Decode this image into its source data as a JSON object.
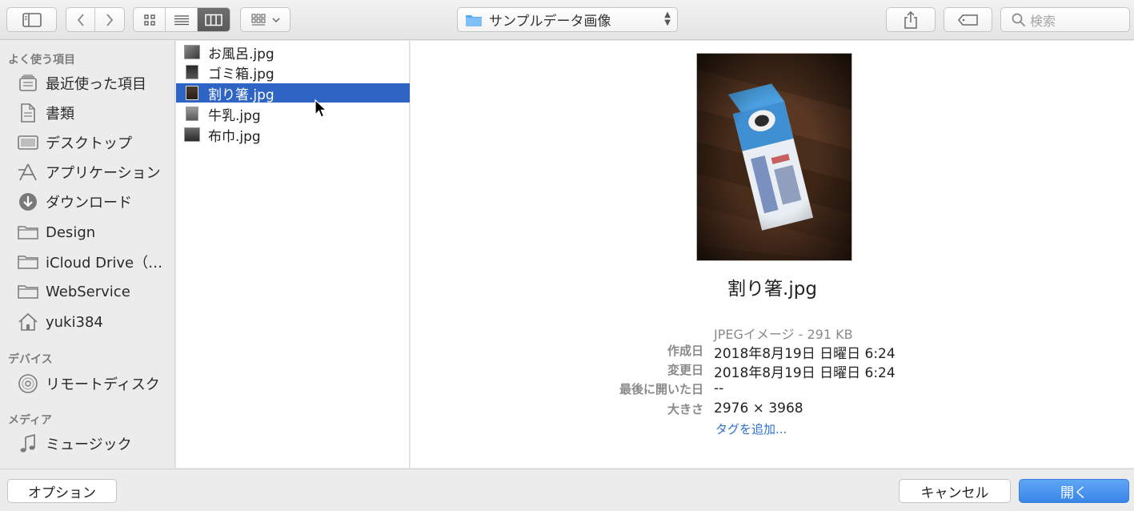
{
  "toolbar": {
    "location": "サンプルデータ画像",
    "search_placeholder": "検索"
  },
  "sidebar": {
    "sections": [
      {
        "heading": "よく使う項目",
        "items": [
          {
            "label": "最近使った項目",
            "icon": "recents-icon"
          },
          {
            "label": "書類",
            "icon": "documents-icon"
          },
          {
            "label": "デスクトップ",
            "icon": "desktop-icon"
          },
          {
            "label": "アプリケーション",
            "icon": "applications-icon"
          },
          {
            "label": "ダウンロード",
            "icon": "downloads-icon"
          },
          {
            "label": "Design",
            "icon": "folder-icon"
          },
          {
            "label": "iCloud Drive（…",
            "icon": "folder-icon"
          },
          {
            "label": "WebService",
            "icon": "folder-icon"
          },
          {
            "label": "yuki384",
            "icon": "home-icon"
          }
        ]
      },
      {
        "heading": "デバイス",
        "items": [
          {
            "label": "リモートディスク",
            "icon": "remote-disc-icon"
          }
        ]
      },
      {
        "heading": "メディア",
        "items": [
          {
            "label": "ミュージック",
            "icon": "music-icon"
          }
        ]
      }
    ]
  },
  "files": [
    {
      "name": "お風呂.jpg",
      "selected": false
    },
    {
      "name": "ゴミ箱.jpg",
      "selected": false
    },
    {
      "name": "割り箸.jpg",
      "selected": true
    },
    {
      "name": "牛乳.jpg",
      "selected": false
    },
    {
      "name": "布巾.jpg",
      "selected": false
    }
  ],
  "preview": {
    "name": "割り箸.jpg",
    "kind": "JPEGイメージ - 291 KB",
    "meta": [
      {
        "key": "作成日",
        "value": "2018年8月19日 日曜日 6:24"
      },
      {
        "key": "変更日",
        "value": "2018年8月19日 日曜日 6:24"
      },
      {
        "key": "最後に開いた日",
        "value": "--"
      },
      {
        "key": "大きさ",
        "value": "2976 × 3968"
      }
    ],
    "add_tag": "タグを追加..."
  },
  "buttons": {
    "options": "オプション",
    "cancel": "キャンセル",
    "open": "開く"
  },
  "colors": {
    "selection": "#2e64c4",
    "accent_button": "#3a85e8",
    "link": "#2f72cc"
  }
}
